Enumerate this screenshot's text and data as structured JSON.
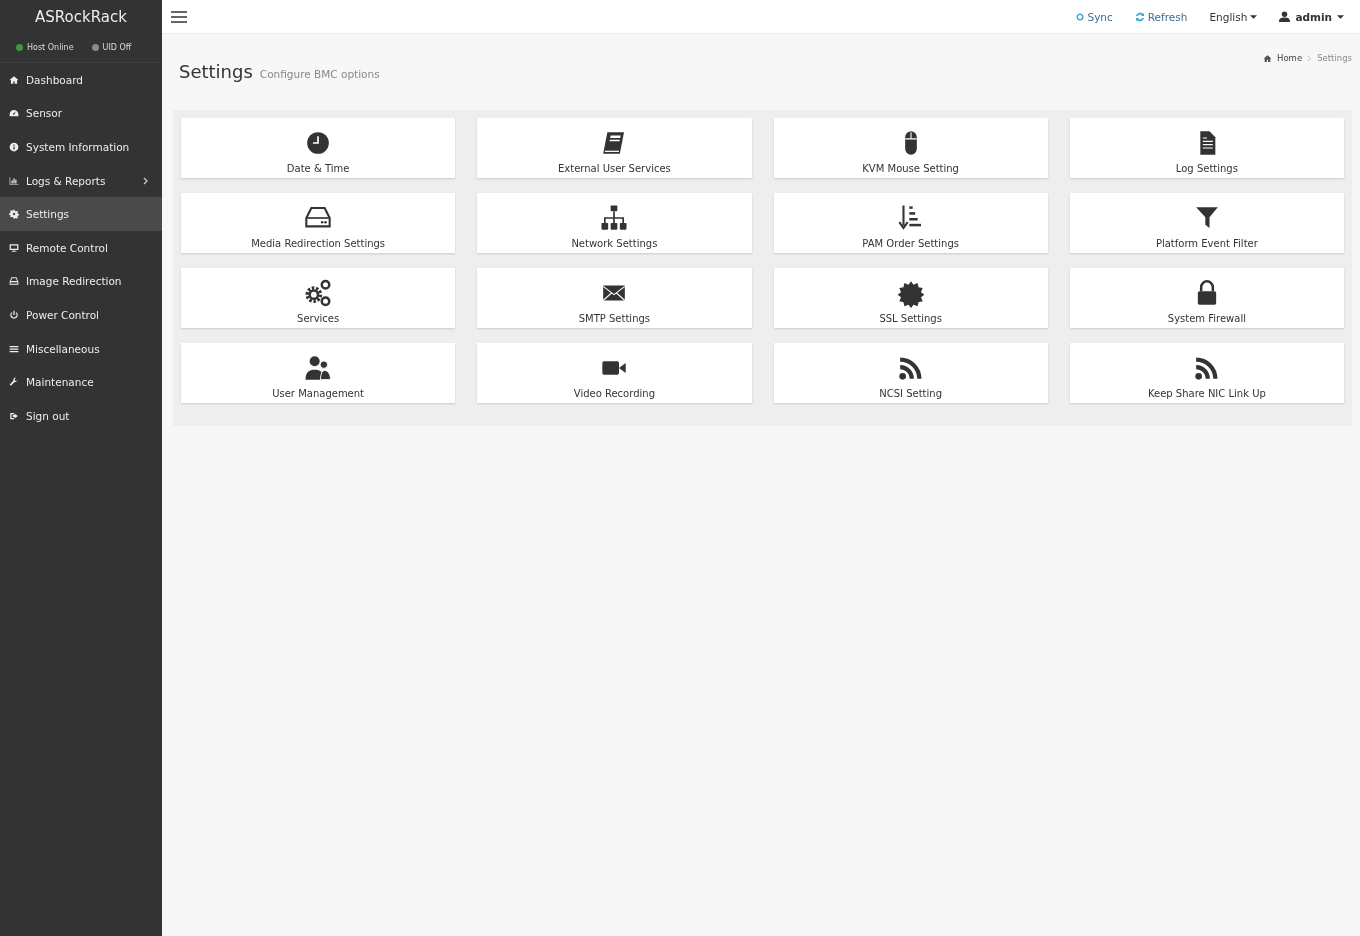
{
  "sidebar": {
    "brand": "ASRockRack",
    "status": [
      {
        "label": "Host Online",
        "color": "#3c9a3c"
      },
      {
        "label": "UID Off",
        "color": "#8a8a8a"
      }
    ],
    "items": [
      {
        "label": "Dashboard",
        "kind": "home",
        "selected": false,
        "has_submenu": false
      },
      {
        "label": "Sensor",
        "kind": "gauge",
        "selected": false,
        "has_submenu": false
      },
      {
        "label": "System Information",
        "kind": "info",
        "selected": false,
        "has_submenu": false
      },
      {
        "label": "Logs & Reports",
        "kind": "chart",
        "selected": false,
        "has_submenu": true
      },
      {
        "label": "Settings",
        "kind": "gear",
        "selected": true,
        "has_submenu": false
      },
      {
        "label": "Remote Control",
        "kind": "monitor",
        "selected": false,
        "has_submenu": false
      },
      {
        "label": "Image Redirection",
        "kind": "drive",
        "selected": false,
        "has_submenu": false
      },
      {
        "label": "Power Control",
        "kind": "power",
        "selected": false,
        "has_submenu": false
      },
      {
        "label": "Miscellaneous",
        "kind": "bars",
        "selected": false,
        "has_submenu": false
      },
      {
        "label": "Maintenance",
        "kind": "wrench",
        "selected": false,
        "has_submenu": false
      },
      {
        "label": "Sign out",
        "kind": "signout",
        "selected": false,
        "has_submenu": false
      }
    ]
  },
  "topbar": {
    "sync": "Sync",
    "refresh": "Refresh",
    "language": "English",
    "user": "admin"
  },
  "page": {
    "title": "Settings",
    "subtitle": "Configure BMC options",
    "breadcrumb": [
      "Home",
      "Settings"
    ]
  },
  "tiles": [
    {
      "label": "Date & Time",
      "kind": "clock"
    },
    {
      "label": "External User Services",
      "kind": "book"
    },
    {
      "label": "KVM Mouse Setting",
      "kind": "mouse"
    },
    {
      "label": "Log Settings",
      "kind": "file"
    },
    {
      "label": "Media Redirection Settings",
      "kind": "drive"
    },
    {
      "label": "Network Settings",
      "kind": "sitemap"
    },
    {
      "label": "PAM Order Settings",
      "kind": "sort"
    },
    {
      "label": "Platform Event Filter",
      "kind": "filter"
    },
    {
      "label": "Services",
      "kind": "gears"
    },
    {
      "label": "SMTP Settings",
      "kind": "envelope"
    },
    {
      "label": "SSL Settings",
      "kind": "badge"
    },
    {
      "label": "System Firewall",
      "kind": "lock"
    },
    {
      "label": "User Management",
      "kind": "users"
    },
    {
      "label": "Video Recording",
      "kind": "video"
    },
    {
      "label": "NCSI Setting",
      "kind": "rss"
    },
    {
      "label": "Keep Share NIC Link Up",
      "kind": "rss"
    }
  ]
}
